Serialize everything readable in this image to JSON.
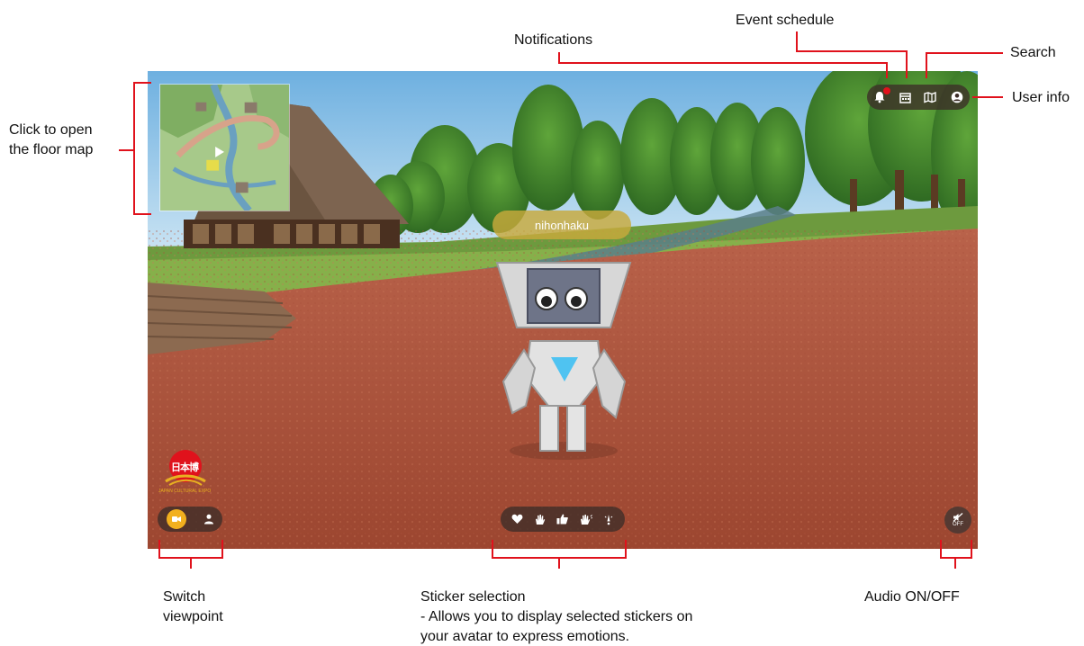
{
  "annotations": {
    "notifications": "Notifications",
    "event_schedule": "Event schedule",
    "search": "Search",
    "user_info": "User info",
    "floor_map_line1": "Click to open",
    "floor_map_line2": "the floor map",
    "switch_viewpoint_line1": "Switch",
    "switch_viewpoint_line2": "viewpoint",
    "sticker_selection_line1": "Sticker selection",
    "sticker_selection_line2": "- Allows you to display selected stickers on",
    "sticker_selection_line3": "your avatar to express emotions.",
    "audio": "Audio ON/OFF"
  },
  "game": {
    "player_name": "nihonhaku",
    "logo_text": "日本博",
    "logo_subtext": "JAPAN CULTURAL EXPO",
    "audio_state": "OFF",
    "notification_badge": "1"
  },
  "icons": {
    "notifications": "bell-icon",
    "event_schedule": "calendar-icon",
    "search": "map-search-icon",
    "user_info": "user-circle-icon",
    "viewpoint_third": "camera-icon",
    "viewpoint_first": "person-icon",
    "stickers": [
      "heart-icon",
      "wave-hand-icon",
      "thumbs-up-icon",
      "clap-hands-icon",
      "exclamation-icon"
    ],
    "audio": "speaker-off-icon"
  },
  "colors": {
    "annotation_line": "#e0121c",
    "hud_background": "#3c2d28",
    "active_viewpoint": "#f2b01e",
    "nametag": "#c8aa3c",
    "ground": "#b5553a",
    "sky": "#8fc3e8"
  }
}
